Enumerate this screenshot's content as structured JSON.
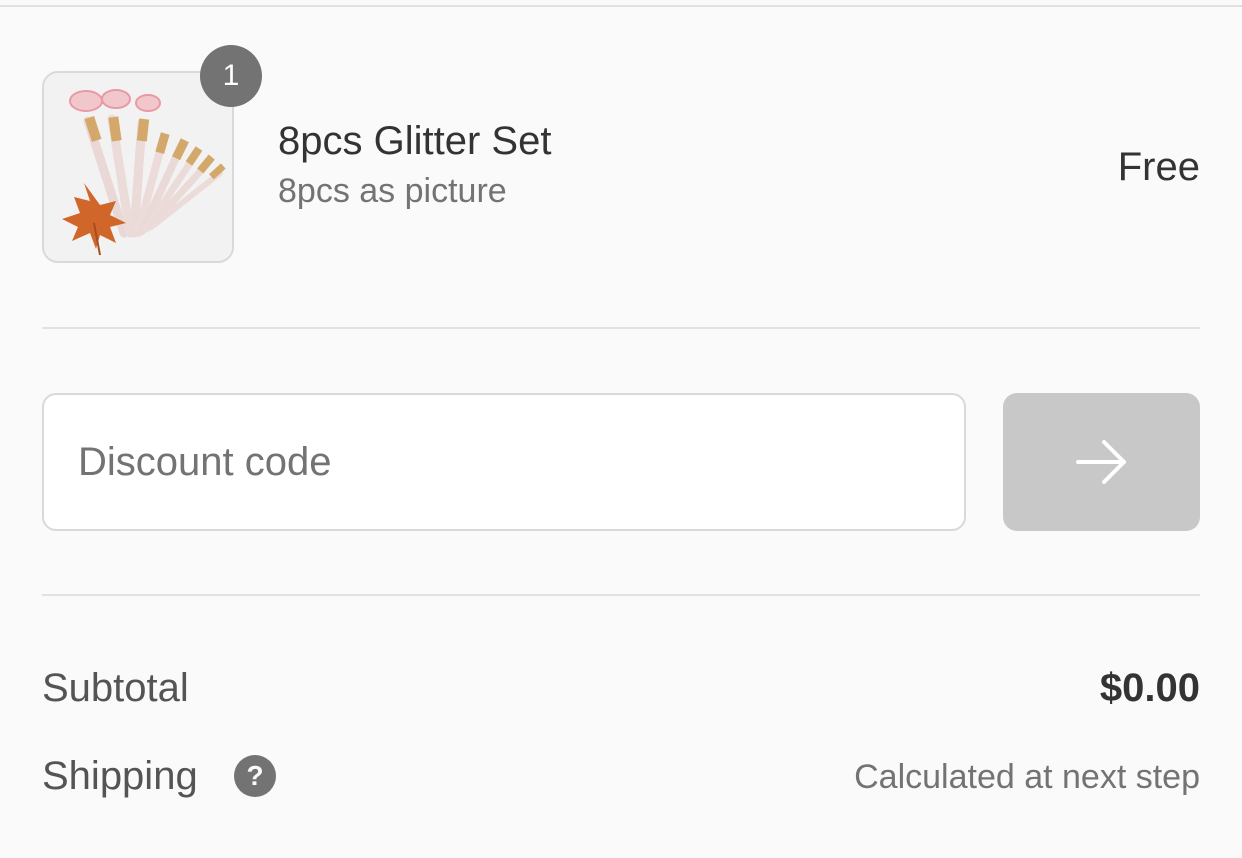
{
  "product": {
    "quantity": "1",
    "name": "8pcs Glitter Set",
    "variant": "8pcs as picture",
    "price": "Free",
    "image_icon": "makeup-brush-set-thumbnail"
  },
  "discount": {
    "placeholder": "Discount code",
    "value": "",
    "apply_icon": "arrow-right-icon"
  },
  "totals": {
    "subtotal_label": "Subtotal",
    "subtotal_value": "$0.00",
    "shipping_label": "Shipping",
    "shipping_help_icon": "?",
    "shipping_value": "Calculated at next step"
  },
  "colors": {
    "background": "#fafafa",
    "border": "#d9d9d9",
    "muted_text": "#737373",
    "badge": "#737373",
    "button_disabled": "#c8c8c8"
  }
}
